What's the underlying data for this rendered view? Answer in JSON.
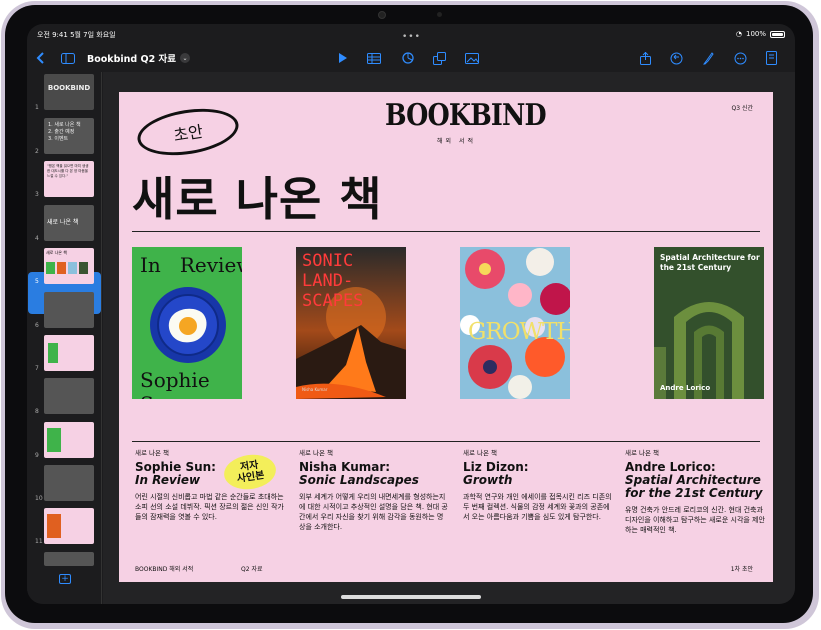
{
  "status": {
    "time": "오전 9:41",
    "date": "5월 7일 화요일",
    "battery": "100%"
  },
  "toolbar": {
    "doc_title": "Bookbind Q2 자료"
  },
  "navigator": {
    "slide_numbers": [
      "1",
      "2",
      "3",
      "4",
      "5",
      "6",
      "7",
      "8",
      "9",
      "10",
      "11"
    ],
    "thumbs": [
      "BOOKBIND",
      "1. 새로 나온 책\n2. 출간 예정\n3. 이벤트",
      "\"평온 책을 읽으면 마치 생생한 대도시를 다 본 양 마음을 느낄 수 있다.\"",
      "새로 나온 책",
      "새로 나온 책",
      "",
      "",
      "",
      "",
      "",
      ""
    ]
  },
  "slide": {
    "logo": "BOOKBIND",
    "subtitle": "해외 서적",
    "quarter": "Q3 신간",
    "draft_stamp": "초안",
    "headline": "새로 나온 책",
    "covers": [
      {
        "top": "In   Review",
        "bottom": "Sophie Sun"
      },
      {
        "title": "SONIC\nLAND-\nSCAPES",
        "author": "Nisha Kumar"
      },
      {
        "title": "GROWTH"
      },
      {
        "title": "Spatial Architecture for the 21st Century",
        "author": "Andre Lorico"
      }
    ],
    "captions": [
      {
        "label": "새로 나온 책",
        "name": "Sophie Sun:",
        "title": "In Review",
        "desc": "어린 시절의 신비롭고 마법 같은 순간들로 초대하는 소피 선의 소설 데뷔작. 픽션 장르의 젊은 신인 작가들의 잠재력을 엿볼 수 있다."
      },
      {
        "label": "새로 나온 책",
        "name": "Nisha Kumar:",
        "title": "Sonic Landscapes",
        "desc": "외부 세계가 어떻게 우리의 내면세계를 형성하는지에 대한 시적이고 추상적인 설명을 담은 책. 현대 공간에서 우리 자신을 찾기 위해 감각을 동원하는 명상을 소개한다."
      },
      {
        "label": "새로 나온 책",
        "name": "Liz Dizon:",
        "title": "Growth",
        "desc": "과학적 연구와 개인 에세이를 접목시킨 리즈 디존의 두 번째 컬렉션. 식물의 감정 세계와 꽃과의 공존에서 오는 아름다움과 기쁨을 심도 있게 탐구한다."
      },
      {
        "label": "새로 나온 책",
        "name": "Andre Lorico:",
        "title": "Spatial Architecture for the 21st Century",
        "desc": "유명 건축가 안드레 로리코의 신간. 현대 건축과 디자인을 이해하고 탐구하는 새로운 시각을 제안하는 매력적인 책."
      }
    ],
    "author_badge": "저자\n사인본",
    "footer": {
      "left": "BOOKBIND 해외 서적",
      "center": "Q2 자료",
      "right": "1차 초안"
    }
  }
}
